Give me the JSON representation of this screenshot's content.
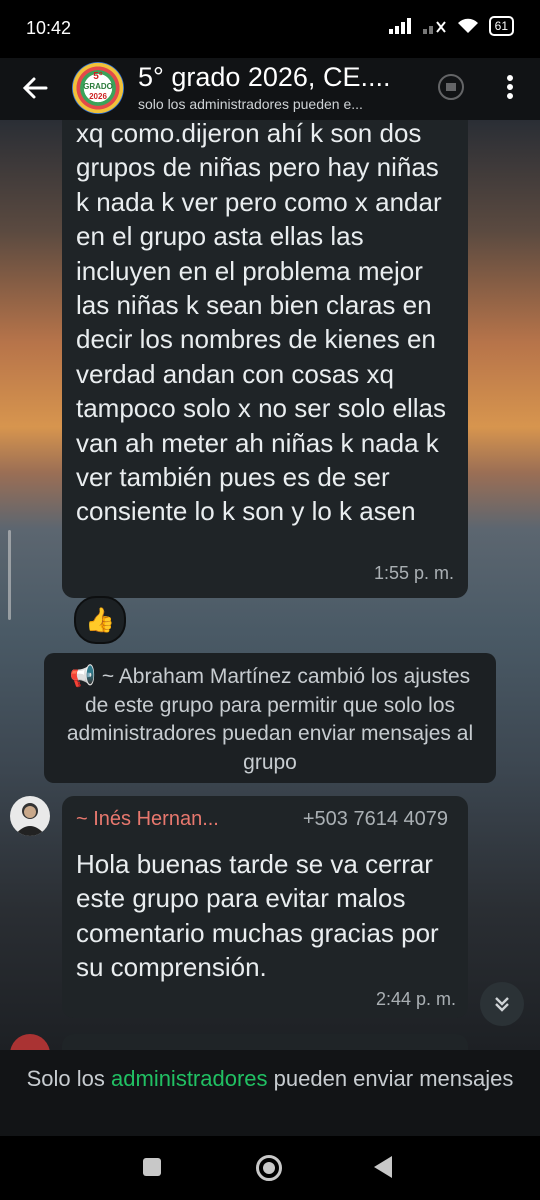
{
  "status_bar": {
    "time": "10:42",
    "battery": "61"
  },
  "header": {
    "avatar_line1": "5°",
    "avatar_line2": "GRADO",
    "avatar_line3": "2026",
    "title": "5° grado 2026, CE....",
    "subtitle": "solo los administradores pueden e..."
  },
  "messages": [
    {
      "type": "incoming",
      "text": "xq como.dijeron ahí k son dos grupos de niñas pero hay niñas k nada k ver pero como x andar en el grupo asta ellas las incluyen en el problema mejor las niñas k sean bien claras en decir los nombres de kienes en verdad andan con cosas xq tampoco solo x no ser solo ellas van ah meter ah niñas k nada k ver también pues es de ser consiente lo k son y lo k asen",
      "time": "1:55 p. m.",
      "reaction": "👍"
    },
    {
      "type": "system",
      "icon": "megaphone-icon",
      "text": "~ Abraham Martínez cambió los ajustes de este grupo para permitir que solo los administradores puedan enviar mensajes al grupo"
    },
    {
      "type": "incoming",
      "sender": "~ Inés Hernan...",
      "sender_color": "#e8786e",
      "phone": "+503 7614 4079",
      "text": "Hola buenas tarde se va cerrar este grupo para evitar malos comentario  muchas gracias por su comprensión.",
      "time": "2:44 p. m."
    }
  ],
  "footer_notice": {
    "prefix": "Solo los ",
    "link": "administradores",
    "suffix": " pueden enviar mensajes"
  },
  "colors": {
    "accent": "#21c063",
    "bubble": "#1f2427",
    "header": "#111315"
  }
}
